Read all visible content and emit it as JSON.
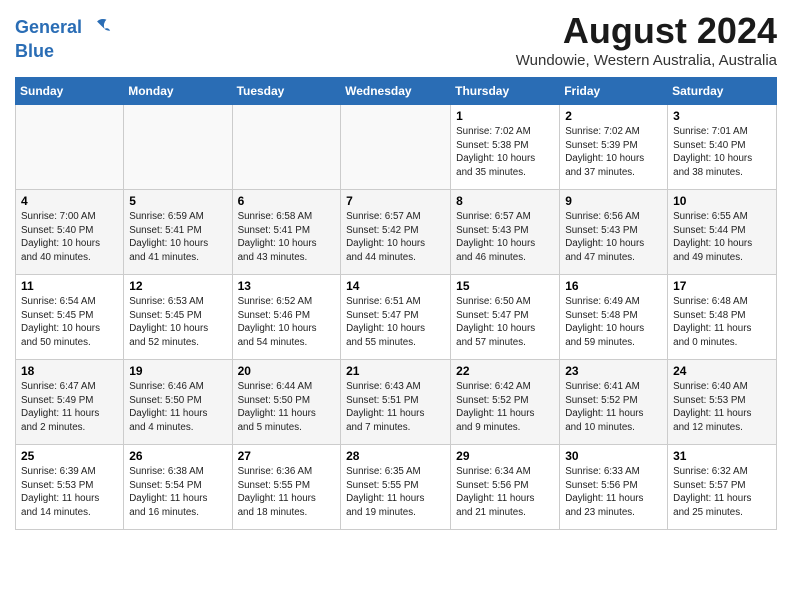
{
  "logo": {
    "line1": "General",
    "line2": "Blue"
  },
  "title": "August 2024",
  "location": "Wundowie, Western Australia, Australia",
  "days_of_week": [
    "Sunday",
    "Monday",
    "Tuesday",
    "Wednesday",
    "Thursday",
    "Friday",
    "Saturday"
  ],
  "weeks": [
    [
      {
        "num": "",
        "info": ""
      },
      {
        "num": "",
        "info": ""
      },
      {
        "num": "",
        "info": ""
      },
      {
        "num": "",
        "info": ""
      },
      {
        "num": "1",
        "info": "Sunrise: 7:02 AM\nSunset: 5:38 PM\nDaylight: 10 hours\nand 35 minutes."
      },
      {
        "num": "2",
        "info": "Sunrise: 7:02 AM\nSunset: 5:39 PM\nDaylight: 10 hours\nand 37 minutes."
      },
      {
        "num": "3",
        "info": "Sunrise: 7:01 AM\nSunset: 5:40 PM\nDaylight: 10 hours\nand 38 minutes."
      }
    ],
    [
      {
        "num": "4",
        "info": "Sunrise: 7:00 AM\nSunset: 5:40 PM\nDaylight: 10 hours\nand 40 minutes."
      },
      {
        "num": "5",
        "info": "Sunrise: 6:59 AM\nSunset: 5:41 PM\nDaylight: 10 hours\nand 41 minutes."
      },
      {
        "num": "6",
        "info": "Sunrise: 6:58 AM\nSunset: 5:41 PM\nDaylight: 10 hours\nand 43 minutes."
      },
      {
        "num": "7",
        "info": "Sunrise: 6:57 AM\nSunset: 5:42 PM\nDaylight: 10 hours\nand 44 minutes."
      },
      {
        "num": "8",
        "info": "Sunrise: 6:57 AM\nSunset: 5:43 PM\nDaylight: 10 hours\nand 46 minutes."
      },
      {
        "num": "9",
        "info": "Sunrise: 6:56 AM\nSunset: 5:43 PM\nDaylight: 10 hours\nand 47 minutes."
      },
      {
        "num": "10",
        "info": "Sunrise: 6:55 AM\nSunset: 5:44 PM\nDaylight: 10 hours\nand 49 minutes."
      }
    ],
    [
      {
        "num": "11",
        "info": "Sunrise: 6:54 AM\nSunset: 5:45 PM\nDaylight: 10 hours\nand 50 minutes."
      },
      {
        "num": "12",
        "info": "Sunrise: 6:53 AM\nSunset: 5:45 PM\nDaylight: 10 hours\nand 52 minutes."
      },
      {
        "num": "13",
        "info": "Sunrise: 6:52 AM\nSunset: 5:46 PM\nDaylight: 10 hours\nand 54 minutes."
      },
      {
        "num": "14",
        "info": "Sunrise: 6:51 AM\nSunset: 5:47 PM\nDaylight: 10 hours\nand 55 minutes."
      },
      {
        "num": "15",
        "info": "Sunrise: 6:50 AM\nSunset: 5:47 PM\nDaylight: 10 hours\nand 57 minutes."
      },
      {
        "num": "16",
        "info": "Sunrise: 6:49 AM\nSunset: 5:48 PM\nDaylight: 10 hours\nand 59 minutes."
      },
      {
        "num": "17",
        "info": "Sunrise: 6:48 AM\nSunset: 5:48 PM\nDaylight: 11 hours\nand 0 minutes."
      }
    ],
    [
      {
        "num": "18",
        "info": "Sunrise: 6:47 AM\nSunset: 5:49 PM\nDaylight: 11 hours\nand 2 minutes."
      },
      {
        "num": "19",
        "info": "Sunrise: 6:46 AM\nSunset: 5:50 PM\nDaylight: 11 hours\nand 4 minutes."
      },
      {
        "num": "20",
        "info": "Sunrise: 6:44 AM\nSunset: 5:50 PM\nDaylight: 11 hours\nand 5 minutes."
      },
      {
        "num": "21",
        "info": "Sunrise: 6:43 AM\nSunset: 5:51 PM\nDaylight: 11 hours\nand 7 minutes."
      },
      {
        "num": "22",
        "info": "Sunrise: 6:42 AM\nSunset: 5:52 PM\nDaylight: 11 hours\nand 9 minutes."
      },
      {
        "num": "23",
        "info": "Sunrise: 6:41 AM\nSunset: 5:52 PM\nDaylight: 11 hours\nand 10 minutes."
      },
      {
        "num": "24",
        "info": "Sunrise: 6:40 AM\nSunset: 5:53 PM\nDaylight: 11 hours\nand 12 minutes."
      }
    ],
    [
      {
        "num": "25",
        "info": "Sunrise: 6:39 AM\nSunset: 5:53 PM\nDaylight: 11 hours\nand 14 minutes."
      },
      {
        "num": "26",
        "info": "Sunrise: 6:38 AM\nSunset: 5:54 PM\nDaylight: 11 hours\nand 16 minutes."
      },
      {
        "num": "27",
        "info": "Sunrise: 6:36 AM\nSunset: 5:55 PM\nDaylight: 11 hours\nand 18 minutes."
      },
      {
        "num": "28",
        "info": "Sunrise: 6:35 AM\nSunset: 5:55 PM\nDaylight: 11 hours\nand 19 minutes."
      },
      {
        "num": "29",
        "info": "Sunrise: 6:34 AM\nSunset: 5:56 PM\nDaylight: 11 hours\nand 21 minutes."
      },
      {
        "num": "30",
        "info": "Sunrise: 6:33 AM\nSunset: 5:56 PM\nDaylight: 11 hours\nand 23 minutes."
      },
      {
        "num": "31",
        "info": "Sunrise: 6:32 AM\nSunset: 5:57 PM\nDaylight: 11 hours\nand 25 minutes."
      }
    ]
  ]
}
